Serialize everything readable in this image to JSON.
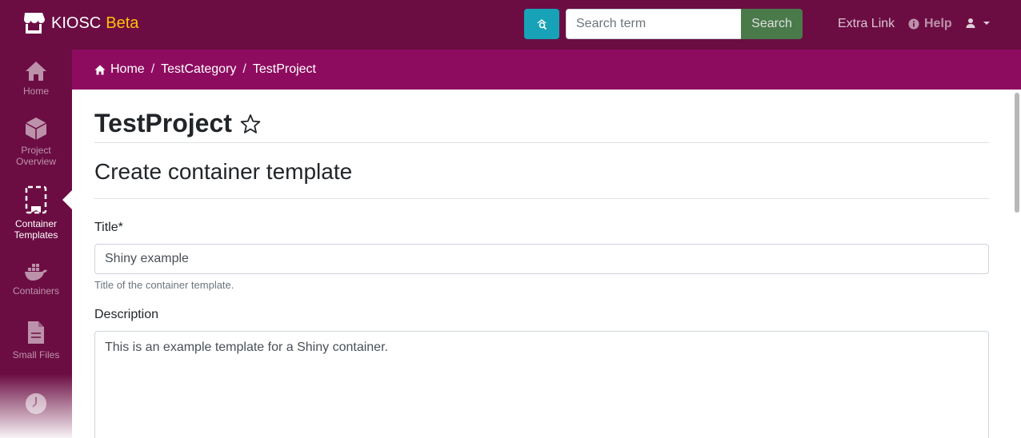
{
  "brand": {
    "name": "KIOSC",
    "tag": "Beta",
    "icon": "store-icon"
  },
  "search": {
    "placeholder": "Search term",
    "value": "",
    "button_label": "Search",
    "advanced_icon": "search-advanced-icon"
  },
  "nav": {
    "extra_link": "Extra Link",
    "help_label": "Help",
    "user_icon": "user-icon"
  },
  "sidebar": {
    "items": [
      {
        "label": "Home",
        "icon": "home-icon"
      },
      {
        "label": "Project Overview",
        "icon": "cube-icon"
      },
      {
        "label": "Container Templates",
        "icon": "template-icon",
        "active": true
      },
      {
        "label": "Containers",
        "icon": "docker-icon"
      },
      {
        "label": "Small Files",
        "icon": "file-icon"
      },
      {
        "label": "",
        "icon": "clock-icon"
      }
    ]
  },
  "breadcrumb": {
    "home": "Home",
    "category": "TestCategory",
    "project": "TestProject",
    "separator": "/"
  },
  "page": {
    "project_title": "TestProject",
    "heading": "Create container template"
  },
  "form": {
    "title_label": "Title*",
    "title_value": "Shiny example",
    "title_help": "Title of the container template.",
    "description_label": "Description",
    "description_value": "This is an example template for a Shiny container."
  },
  "colors": {
    "navbar": "#6b0d43",
    "breadcrumb_bar": "#8e0c60",
    "brand_tag": "#ffc107",
    "search_advanced": "#17a2b8",
    "search_button": "#4a7a4a"
  }
}
